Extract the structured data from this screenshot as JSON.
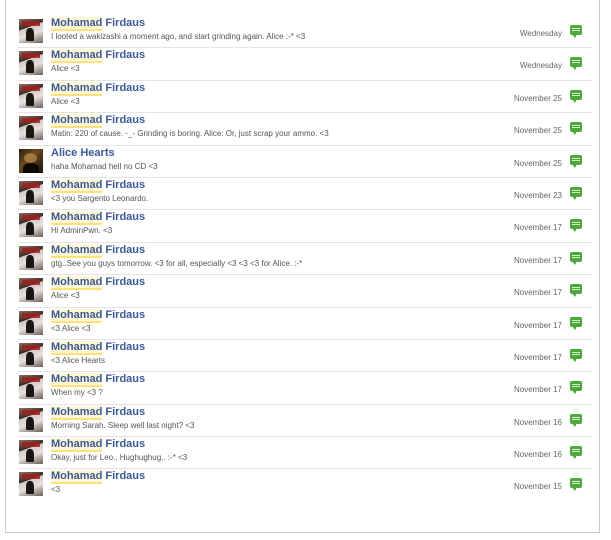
{
  "messages": [
    {
      "first": "Mohamad",
      "last": "Firdaus",
      "snippet": "I looted a wakizashi a moment ago, and start grinding again. Alice :-* <3",
      "date": "Wednesday",
      "avatar": "mohamad"
    },
    {
      "first": "Mohamad",
      "last": "Firdaus",
      "snippet": "Alice <3",
      "date": "Wednesday",
      "avatar": "mohamad"
    },
    {
      "first": "Mohamad",
      "last": "Firdaus",
      "snippet": "Alice <3",
      "date": "November 25",
      "avatar": "mohamad"
    },
    {
      "first": "Mohamad",
      "last": "Firdaus",
      "snippet": "Matin: 220 of cause. -_- Grinding is boring. Alice: Or, just scrap your ammo. <3",
      "date": "November 25",
      "avatar": "mohamad"
    },
    {
      "first": "Alice",
      "last": "Hearts",
      "snippet": "haha Mohamad hell no CD <3",
      "date": "November 25",
      "avatar": "alice"
    },
    {
      "first": "Mohamad",
      "last": "Firdaus",
      "snippet": "<3 you Sargento Leonardo.",
      "date": "November 23",
      "avatar": "mohamad"
    },
    {
      "first": "Mohamad",
      "last": "Firdaus",
      "snippet": "Hi AdminPwn. <3",
      "date": "November 17",
      "avatar": "mohamad"
    },
    {
      "first": "Mohamad",
      "last": "Firdaus",
      "snippet": "gtg..See you guys tomorrow. <3 for all, especially <3 <3 <3 for Alice. :-*",
      "date": "November 17",
      "avatar": "mohamad"
    },
    {
      "first": "Mohamad",
      "last": "Firdaus",
      "snippet": "Alice <3",
      "date": "November 17",
      "avatar": "mohamad"
    },
    {
      "first": "Mohamad",
      "last": "Firdaus",
      "snippet": "<3 Alice <3",
      "date": "November 17",
      "avatar": "mohamad"
    },
    {
      "first": "Mohamad",
      "last": "Firdaus",
      "snippet": "<3 Alice Hearts",
      "date": "November 17",
      "avatar": "mohamad"
    },
    {
      "first": "Mohamad",
      "last": "Firdaus",
      "snippet": "When my <3 ?",
      "date": "November 17",
      "avatar": "mohamad"
    },
    {
      "first": "Mohamad",
      "last": "Firdaus",
      "snippet": "Morning Sarah. Sleep well last night? <3",
      "date": "November 16",
      "avatar": "mohamad"
    },
    {
      "first": "Mohamad",
      "last": "Firdaus",
      "snippet": "Okay, just for Leo.. Hughughug.. :-* <3",
      "date": "November 16",
      "avatar": "mohamad"
    },
    {
      "first": "Mohamad",
      "last": "Firdaus",
      "snippet": "<3",
      "date": "November 15",
      "avatar": "mohamad"
    }
  ],
  "colors": {
    "name": "#3b5998",
    "highlight": "#ffe07a",
    "reply_icon": "#4ea83b"
  },
  "icons": {
    "reply": "reply-speech-bubble-icon",
    "avatar": "profile-photo"
  }
}
